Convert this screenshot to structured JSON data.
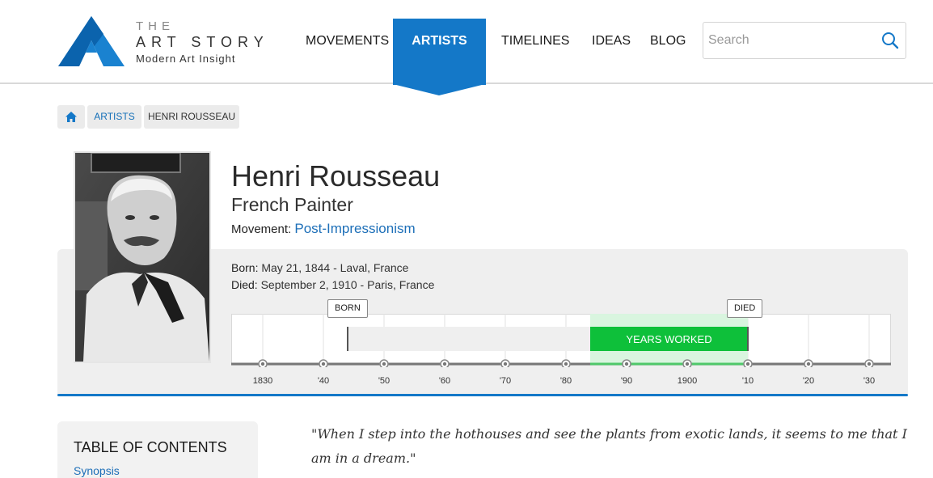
{
  "logo": {
    "the": "THE",
    "name": "ART STORY",
    "tagline": "Modern Art Insight"
  },
  "nav": {
    "items": [
      {
        "label": "MOVEMENTS"
      },
      {
        "label": "ARTISTS",
        "active": true
      },
      {
        "label": "TIMELINES"
      },
      {
        "label": "IDEAS"
      },
      {
        "label": "BLOG"
      }
    ]
  },
  "search": {
    "placeholder": "Search",
    "value": ""
  },
  "breadcrumb": {
    "home_icon": "home-icon",
    "items": [
      "ARTISTS",
      "HENRI ROUSSEAU"
    ]
  },
  "artist": {
    "name": "Henri Rousseau",
    "role": "French Painter",
    "movement_label": "Movement:",
    "movement": "Post-Impressionism",
    "born_label": "Born:",
    "born": "May 21, 1844 - Laval, France",
    "died_label": "Died:",
    "died": "September 2, 1910 - Paris, France"
  },
  "timeline": {
    "born_flag": "BORN",
    "died_flag": "DIED",
    "worked_label": "YEARS WORKED",
    "axis_labels": [
      "1830",
      "'40",
      "'50",
      "'60",
      "'70",
      "'80",
      "'90",
      "1900",
      "'10",
      "'20",
      "'30"
    ],
    "born_year": 1844,
    "work_start_year": 1884,
    "died_year": 1910
  },
  "toc": {
    "title": "TABLE OF CONTENTS",
    "first_link": "Synopsis"
  },
  "quote": "\"When I step into the hothouses and see the plants from exotic lands, it seems to me that I am in a dream.\"",
  "colors": {
    "brand_blue": "#1478c8",
    "worked_green": "#0ec03a",
    "link_blue": "#1d6fb8"
  }
}
